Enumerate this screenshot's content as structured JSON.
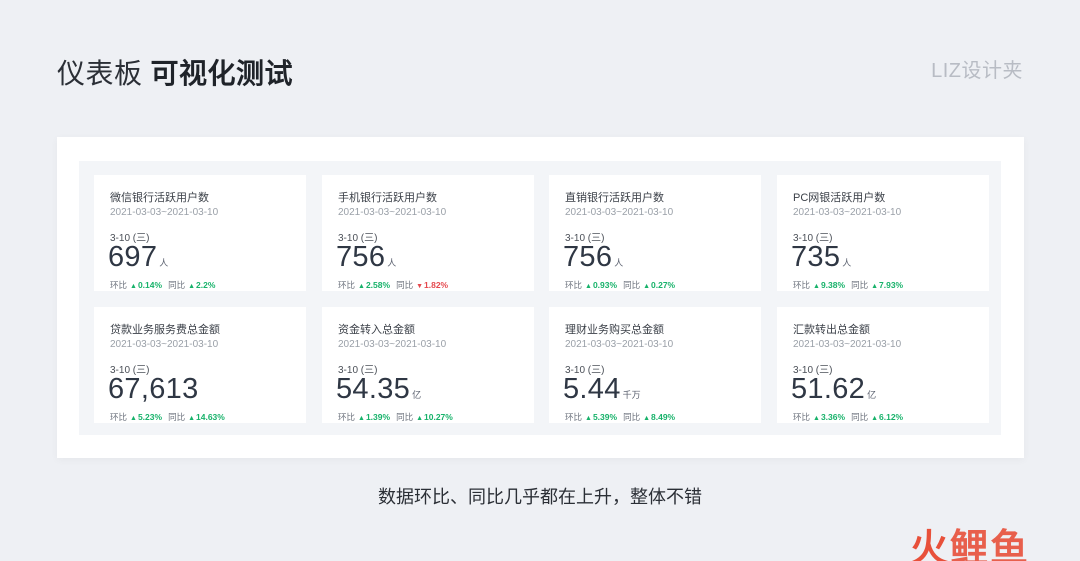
{
  "header": {
    "title_light": "仪表板",
    "title_bold": "可视化测试",
    "brand": "LIZ设计夹"
  },
  "colors": {
    "up": "#17b26a",
    "down": "#e5484d",
    "value": "#2f3744"
  },
  "cards": [
    {
      "name": "微信银行活跃用户数",
      "range": "2021-03-03~2021-03-10",
      "day": "3-10 (三)",
      "value": "697",
      "unit": "人",
      "mom_label": "环比",
      "mom_dir": "up",
      "mom": "0.14%",
      "yoy_label": "同比",
      "yoy_dir": "up",
      "yoy": "2.2%"
    },
    {
      "name": "手机银行活跃用户数",
      "range": "2021-03-03~2021-03-10",
      "day": "3-10 (三)",
      "value": "756",
      "unit": "人",
      "mom_label": "环比",
      "mom_dir": "up",
      "mom": "2.58%",
      "yoy_label": "同比",
      "yoy_dir": "down",
      "yoy": "1.82%"
    },
    {
      "name": "直销银行活跃用户数",
      "range": "2021-03-03~2021-03-10",
      "day": "3-10 (三)",
      "value": "756",
      "unit": "人",
      "mom_label": "环比",
      "mom_dir": "up",
      "mom": "0.93%",
      "yoy_label": "同比",
      "yoy_dir": "up",
      "yoy": "0.27%"
    },
    {
      "name": "PC网银活跃用户数",
      "range": "2021-03-03~2021-03-10",
      "day": "3-10 (三)",
      "value": "735",
      "unit": "人",
      "mom_label": "环比",
      "mom_dir": "up",
      "mom": "9.38%",
      "yoy_label": "同比",
      "yoy_dir": "up",
      "yoy": "7.93%"
    },
    {
      "name": "贷款业务服务费总金额",
      "range": "2021-03-03~2021-03-10",
      "day": "3-10 (三)",
      "value": "67,613",
      "unit": "",
      "mom_label": "环比",
      "mom_dir": "up",
      "mom": "5.23%",
      "yoy_label": "同比",
      "yoy_dir": "up",
      "yoy": "14.63%"
    },
    {
      "name": "资金转入总金额",
      "range": "2021-03-03~2021-03-10",
      "day": "3-10 (三)",
      "value": "54.35",
      "unit": "亿",
      "mom_label": "环比",
      "mom_dir": "up",
      "mom": "1.39%",
      "yoy_label": "同比",
      "yoy_dir": "up",
      "yoy": "10.27%"
    },
    {
      "name": "理财业务购买总金额",
      "range": "2021-03-03~2021-03-10",
      "day": "3-10 (三)",
      "value": "5.44",
      "unit": "千万",
      "mom_label": "环比",
      "mom_dir": "up",
      "mom": "5.39%",
      "yoy_label": "同比",
      "yoy_dir": "up",
      "yoy": "8.49%"
    },
    {
      "name": "汇款转出总金额",
      "range": "2021-03-03~2021-03-10",
      "day": "3-10 (三)",
      "value": "51.62",
      "unit": "亿",
      "mom_label": "环比",
      "mom_dir": "up",
      "mom": "3.36%",
      "yoy_label": "同比",
      "yoy_dir": "up",
      "yoy": "6.12%"
    }
  ],
  "caption": "数据环比、同比几乎都在上升，整体不错",
  "watermark": {
    "part1": "火",
    "part2": "鲤鱼"
  }
}
